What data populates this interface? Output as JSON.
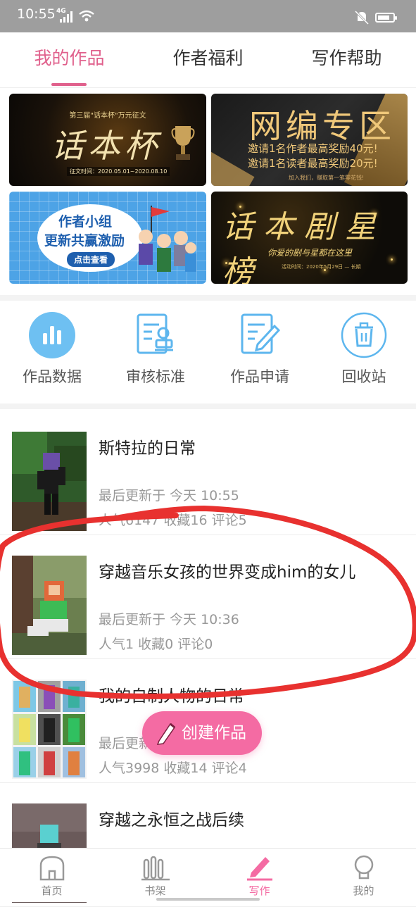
{
  "status_bar": {
    "time": "10:55",
    "network": "4G"
  },
  "tabs": [
    {
      "label": "我的作品",
      "active": true
    },
    {
      "label": "作者福利",
      "active": false
    },
    {
      "label": "写作帮助",
      "active": false
    }
  ],
  "banners": {
    "b1": {
      "subtitle": "第三届\"话本杯\"万元征文",
      "title": "话本杯",
      "date": "征文时间：2020.05.01~2020.08.10"
    },
    "b2": {
      "title": "网编专区",
      "line1": "邀请1名作者最高奖励40元!",
      "line2": "邀请1名读者最高奖励20元!",
      "foot": "加入我们，赚取第一笔零花钱!"
    },
    "b3": {
      "line1": "作者小组",
      "line2": "更新共赢激励",
      "button": "点击查看"
    },
    "b4": {
      "title": "话本剧星榜",
      "tagline": "你爱的剧与星都在这里",
      "foot": "活动时间：2020年5月29日 — 长期"
    }
  },
  "tools": [
    {
      "label": "作品数据",
      "icon": "bar-chart-icon"
    },
    {
      "label": "审核标准",
      "icon": "review-doc-icon"
    },
    {
      "label": "作品申请",
      "icon": "edit-doc-icon"
    },
    {
      "label": "回收站",
      "icon": "trash-icon"
    }
  ],
  "works": [
    {
      "title": "斯特拉的日常",
      "updated": "最后更新于 今天 10:55",
      "stats": "人气6147  收藏16  评论5"
    },
    {
      "title": "穿越音乐女孩的世界变成him的女儿",
      "updated": "最后更新于 今天 10:36",
      "stats": "人气1  收藏0  评论0"
    },
    {
      "title": "我的自制人物的日常",
      "updated": "最后更新于",
      "stats": "人气3998  收藏14  评论4"
    },
    {
      "title": "穿越之永恒之战后续",
      "updated": "",
      "stats": ""
    }
  ],
  "fab": {
    "label": "创建作品"
  },
  "bottom_nav": [
    {
      "label": "首页",
      "icon": "home-icon",
      "active": false
    },
    {
      "label": "书架",
      "icon": "bookshelf-icon",
      "active": false
    },
    {
      "label": "写作",
      "icon": "pen-icon",
      "active": true
    },
    {
      "label": "我的",
      "icon": "profile-icon",
      "active": false
    }
  ],
  "colors": {
    "accent": "#e0608c",
    "fab": "#f46ba3",
    "tool_icon": "#5db6ee",
    "annotation": "#e8312f"
  }
}
